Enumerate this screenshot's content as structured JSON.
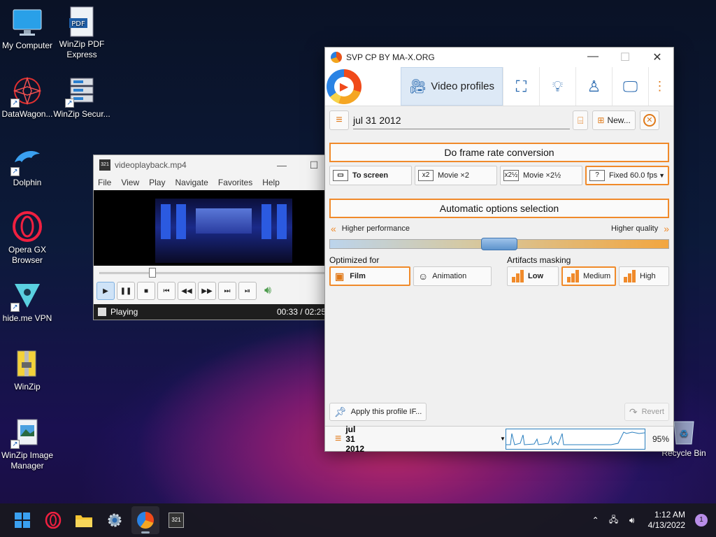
{
  "desktop": {
    "icons": [
      {
        "label": "My Computer",
        "icon": "monitor-icon"
      },
      {
        "label": "WinZip PDF Express",
        "icon": "pdf-icon"
      },
      {
        "label": "DataWagon...",
        "icon": "datawagon-icon"
      },
      {
        "label": "WinZip Secur...",
        "icon": "server-icon"
      },
      {
        "label": "Dolphin",
        "icon": "dolphin-icon"
      },
      {
        "label": "Opera GX Browser",
        "icon": "opera-icon"
      },
      {
        "label": "hide.me VPN",
        "icon": "vpn-icon"
      },
      {
        "label": "WinZip",
        "icon": "winzip-icon"
      },
      {
        "label": "WinZip Image Manager",
        "icon": "image-manager-icon"
      }
    ],
    "recycle_bin": "Recycle Bin"
  },
  "mpc": {
    "title": "videoplayback.mp4",
    "menu": [
      "File",
      "View",
      "Play",
      "Navigate",
      "Favorites",
      "Help"
    ],
    "status": "Playing",
    "time": "00:33 / 02:25",
    "seek_fraction": 0.23
  },
  "svp": {
    "title": "SVP CP BY MA-X.ORG",
    "tab_main": "Video profiles",
    "profile_name": "jul 31 2012",
    "new_button": "New...",
    "section1": "Do frame rate conversion",
    "fps_options": [
      {
        "label": "To screen",
        "icon": "screen",
        "selected": false
      },
      {
        "label": "Movie ×2",
        "icon": "x2",
        "selected": false
      },
      {
        "label": "Movie ×2½",
        "icon": "x2½",
        "selected": false
      },
      {
        "label": "Fixed 60.0 fps",
        "icon": "?",
        "selected": true
      }
    ],
    "section2": "Automatic options selection",
    "slider_left": "Higher performance",
    "slider_right": "Higher quality",
    "slider_value": 0.5,
    "optimized_label": "Optimized for",
    "optimized_options": [
      "Film",
      "Animation"
    ],
    "optimized_selected": "Film",
    "artifacts_label": "Artifacts masking",
    "artifacts_options": [
      "Low",
      "Medium",
      "High"
    ],
    "artifacts_selected": "Medium",
    "apply_button": "Apply this profile IF...",
    "revert_button": "Revert",
    "status_profile": "jul 31 2012",
    "status_pct": "95%"
  },
  "taskbar": {
    "time": "1:12 AM",
    "date": "4/13/2022",
    "notifications": "1"
  }
}
